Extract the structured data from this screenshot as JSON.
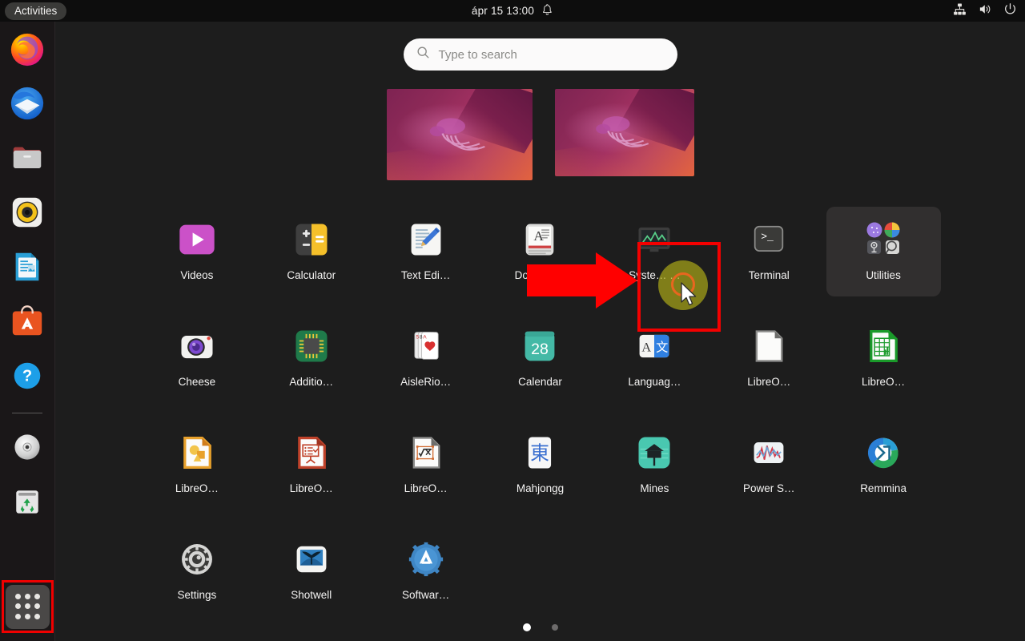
{
  "topbar": {
    "activities_label": "Activities",
    "datetime": "ápr 15  13:00",
    "notifications_icon": "bell-icon",
    "network_icon": "network-wired-icon",
    "volume_icon": "volume-icon",
    "power_icon": "power-icon"
  },
  "search": {
    "placeholder": "Type to search",
    "value": "",
    "icon": "search-icon"
  },
  "dock": {
    "items": [
      {
        "name": "firefox",
        "label": "Firefox"
      },
      {
        "name": "thunderbird",
        "label": "Thunderbird"
      },
      {
        "name": "files",
        "label": "Files"
      },
      {
        "name": "rhythmbox",
        "label": "Rhythmbox"
      },
      {
        "name": "libreoffice-writer",
        "label": "LibreOffice Writer"
      },
      {
        "name": "ubuntu-software",
        "label": "Ubuntu Software"
      },
      {
        "name": "help",
        "label": "Help"
      },
      {
        "name": "disc",
        "label": "Disc"
      },
      {
        "name": "trash",
        "label": "Trash"
      }
    ],
    "show_applications_label": "Show Applications",
    "show_applications_icon": "grid-icon",
    "show_applications_highlighted": true
  },
  "workspaces": [
    {
      "name": "workspace-1",
      "active": true
    },
    {
      "name": "workspace-2",
      "active": false
    }
  ],
  "app_grid": {
    "page": 1,
    "pages": 2,
    "apps": [
      {
        "name": "videos",
        "label": "Videos"
      },
      {
        "name": "calculator",
        "label": "Calculator"
      },
      {
        "name": "text-editor",
        "label": "Text Edi…"
      },
      {
        "name": "document-viewer",
        "label": "Docume…"
      },
      {
        "name": "system-monitor",
        "label": "Syste… …"
      },
      {
        "name": "terminal",
        "label": "Terminal"
      },
      {
        "name": "utilities-folder",
        "label": "Utilities"
      },
      {
        "name": "cheese",
        "label": "Cheese"
      },
      {
        "name": "additional-drivers",
        "label": "Additio…"
      },
      {
        "name": "aisleriot",
        "label": "AisleRio…"
      },
      {
        "name": "calendar",
        "label": "Calendar"
      },
      {
        "name": "language-support",
        "label": "Languag…"
      },
      {
        "name": "libreoffice-start",
        "label": "LibreO…"
      },
      {
        "name": "libreoffice-calc",
        "label": "LibreO…"
      },
      {
        "name": "libreoffice-draw",
        "label": "LibreO…"
      },
      {
        "name": "libreoffice-impress",
        "label": "LibreO…"
      },
      {
        "name": "libreoffice-math",
        "label": "LibreO…"
      },
      {
        "name": "mahjongg",
        "label": "Mahjongg"
      },
      {
        "name": "mines",
        "label": "Mines"
      },
      {
        "name": "power-statistics",
        "label": "Power S…"
      },
      {
        "name": "remmina",
        "label": "Remmina"
      },
      {
        "name": "settings",
        "label": "Settings"
      },
      {
        "name": "shotwell",
        "label": "Shotwell"
      },
      {
        "name": "software-updates",
        "label": "Softwar…"
      }
    ],
    "calendar_day": "28",
    "mahjongg_glyph": "東"
  },
  "annotations": {
    "highlight_color": "#f40000",
    "arrow_color": "#ff0000",
    "click_halo_color": "#b4b218",
    "click_ring_color": "#e8661f",
    "target_app": "terminal"
  }
}
